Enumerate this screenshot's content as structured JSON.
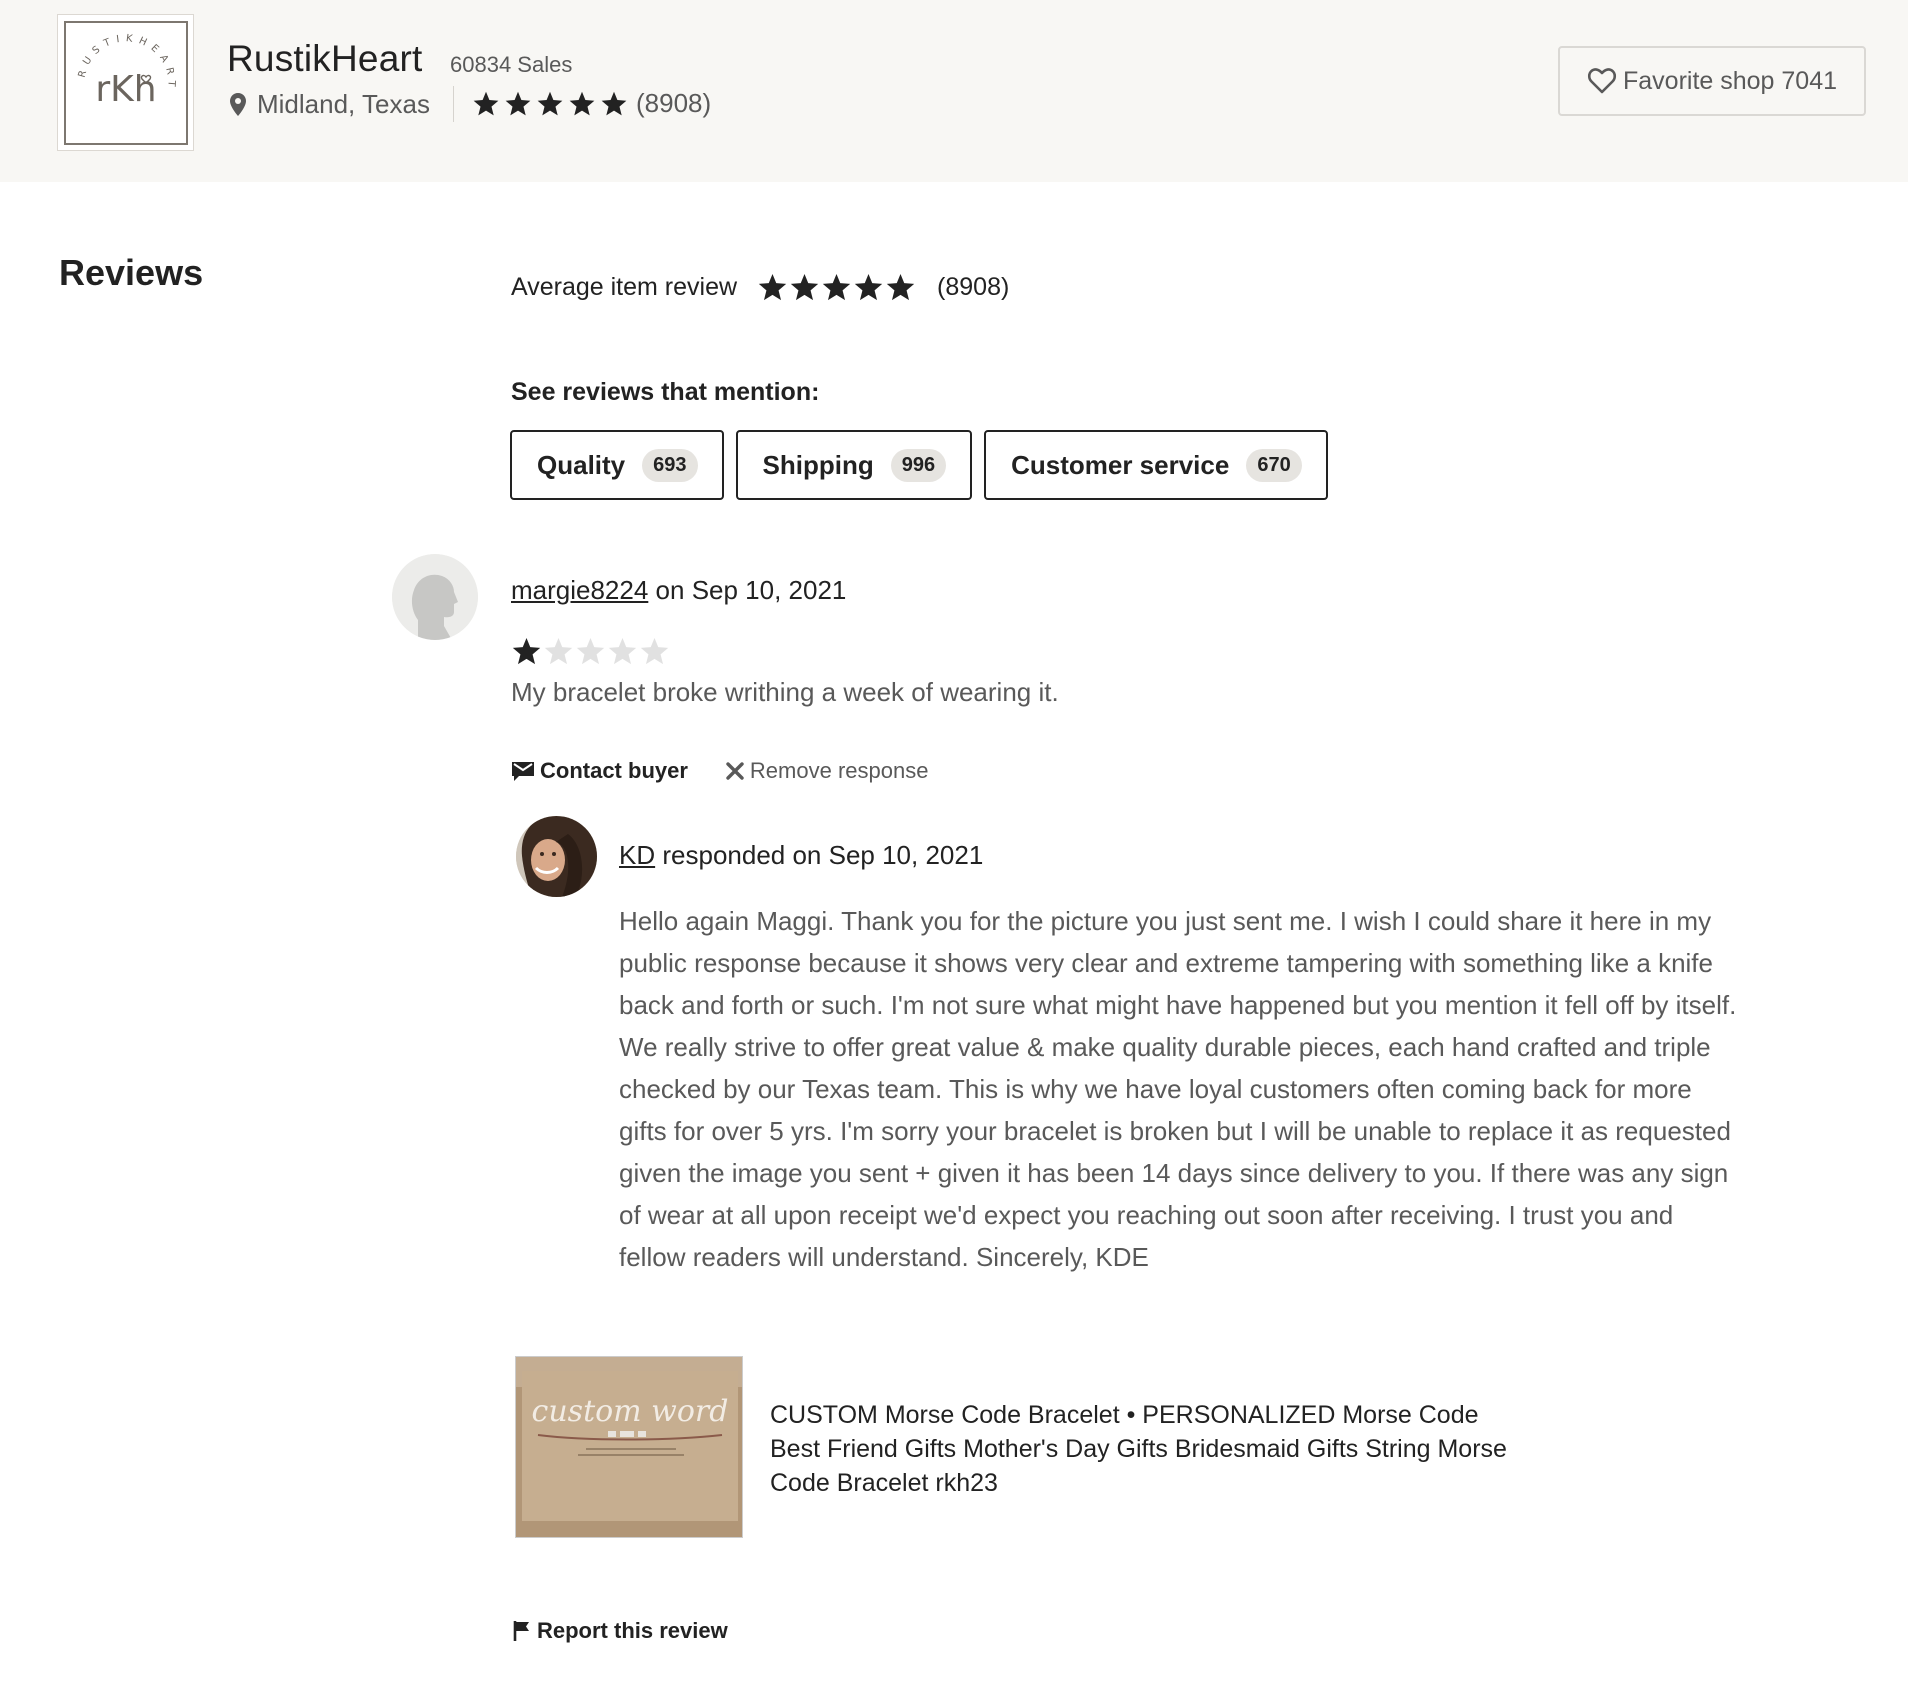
{
  "shop": {
    "name": "RustikHeart",
    "sales": "60834 Sales",
    "location": "Midland, Texas",
    "rating_count": "(8908)",
    "rating_stars": 5,
    "favorite_label": "Favorite shop 7041",
    "logo_text": "rKh",
    "logo_ring_text": "RUSTIKHEART"
  },
  "reviews": {
    "heading": "Reviews",
    "average_label": "Average item review",
    "average_stars": 5,
    "average_count": "(8908)",
    "mention_heading": "See reviews that mention:",
    "filters": [
      {
        "label": "Quality",
        "count": "693"
      },
      {
        "label": "Shipping",
        "count": "996"
      },
      {
        "label": "Customer service",
        "count": "670"
      }
    ]
  },
  "review": {
    "reviewer": "margie8224",
    "date_text": "on Sep 10, 2021",
    "rating": 1,
    "text": "My bracelet broke writhing a week of wearing it.",
    "actions": {
      "contact": "Contact buyer",
      "remove": "Remove response"
    },
    "response": {
      "author": "KD",
      "date_text": "responded on Sep 10, 2021",
      "text": "Hello again Maggi. Thank you for the picture you just sent me. I wish I could share it here in my public response because it shows very clear and extreme tampering with something like a knife back and forth or such. I'm not sure what might have happened but you mention it fell off by itself. We really strive to offer great value & make quality durable pieces, each hand crafted and triple checked by our Texas team. This is why we have loyal customers often coming back for more gifts for over 5 yrs. I'm sorry your bracelet is broken but I will be unable to replace it as requested given the image you sent + given it has been 14 days since delivery to you. If there was any sign of wear at all upon receipt we'd expect you reaching out soon after receiving. I trust you and fellow readers will understand. Sincerely, KDE"
    },
    "product": {
      "title": "CUSTOM Morse Code Bracelet • PERSONALIZED Morse Code Best Friend Gifts Mother's Day Gifts Bridesmaid Gifts String Morse Code Bracelet rkh23",
      "image_text": "custom word"
    },
    "report_label": "Report this review"
  },
  "colors": {
    "header_bg": "#f8f7f4",
    "text_primary": "#222222",
    "text_secondary": "#595959",
    "star_filled": "#222222",
    "star_empty": "#e1e1e1"
  }
}
